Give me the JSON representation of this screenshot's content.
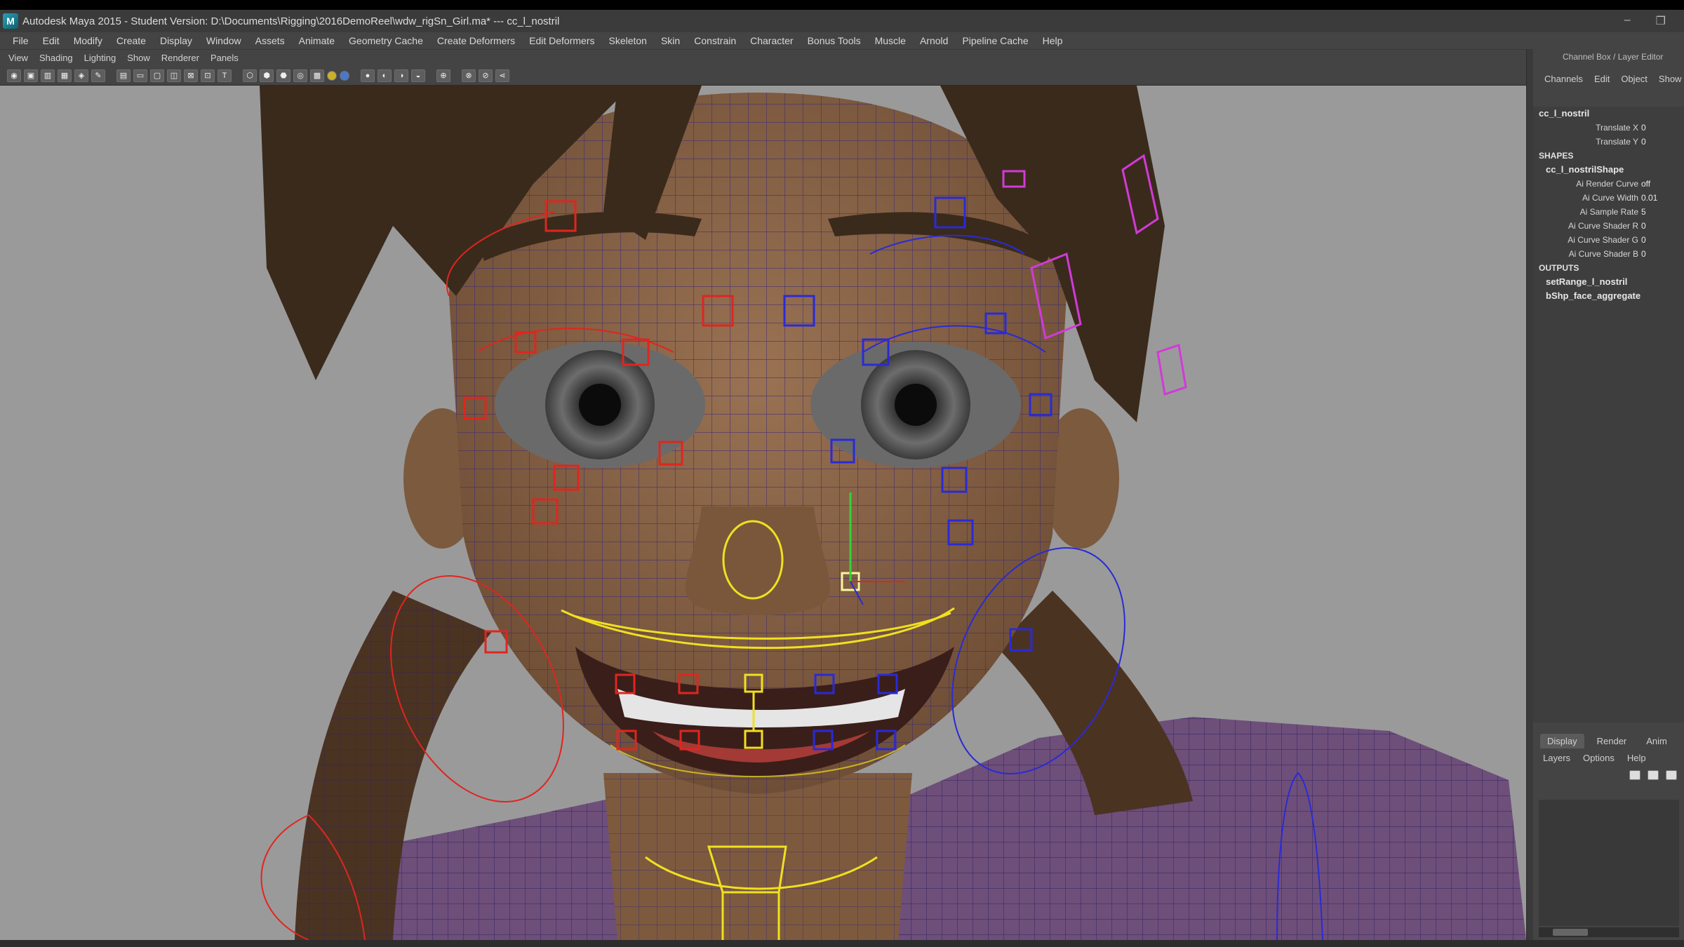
{
  "window": {
    "title": "Autodesk Maya 2015 - Student Version: D:\\Documents\\Rigging\\2016DemoReel\\wdw_rigSn_Girl.ma*   ---   cc_l_nostril",
    "minimize_glyph": "–",
    "restore_glyph": "❐"
  },
  "menubar": {
    "items": [
      "File",
      "Edit",
      "Modify",
      "Create",
      "Display",
      "Window",
      "Assets",
      "Animate",
      "Geometry Cache",
      "Create Deformers",
      "Edit Deformers",
      "Skeleton",
      "Skin",
      "Constrain",
      "Character",
      "Bonus Tools",
      "Muscle",
      "Arnold",
      "Pipeline Cache",
      "Help"
    ]
  },
  "panel_menus": {
    "items": [
      "View",
      "Shading",
      "Lighting",
      "Show",
      "Renderer",
      "Panels"
    ]
  },
  "channel_box": {
    "header": "Channel Box / Layer Editor",
    "tabs": [
      "Channels",
      "Edit",
      "Object",
      "Show"
    ],
    "node": "cc_l_nostril",
    "attributes": [
      {
        "name": "Translate X",
        "value": "0"
      },
      {
        "name": "Translate Y",
        "value": "0"
      }
    ],
    "shapes_label": "SHAPES",
    "shape_node": "cc_l_nostrilShape",
    "shape_attributes": [
      {
        "name": "Ai Render Curve",
        "value": "off"
      },
      {
        "name": "Ai Curve Width",
        "value": "0.01"
      },
      {
        "name": "Ai Sample Rate",
        "value": "5"
      },
      {
        "name": "Ai Curve Shader R",
        "value": "0"
      },
      {
        "name": "Ai Curve Shader G",
        "value": "0"
      },
      {
        "name": "Ai Curve Shader B",
        "value": "0"
      }
    ],
    "outputs_label": "OUTPUTS",
    "outputs": [
      "setRange_l_nostril",
      "bShp_face_aggregate"
    ]
  },
  "layer_editor": {
    "tabs": [
      "Display",
      "Render",
      "Anim"
    ],
    "active_tab": "Display",
    "menus": [
      "Layers",
      "Options",
      "Help"
    ]
  },
  "colors": {
    "viewport_bg": "#9a9a9a",
    "skin": "#8a6546",
    "hair": "#3a2a1c",
    "shirt": "#6e4f7a",
    "ctrl_red": "#e0251f",
    "ctrl_blue": "#2a2ad8",
    "ctrl_yellow": "#f0e020",
    "ctrl_magenta": "#d23ad8"
  }
}
